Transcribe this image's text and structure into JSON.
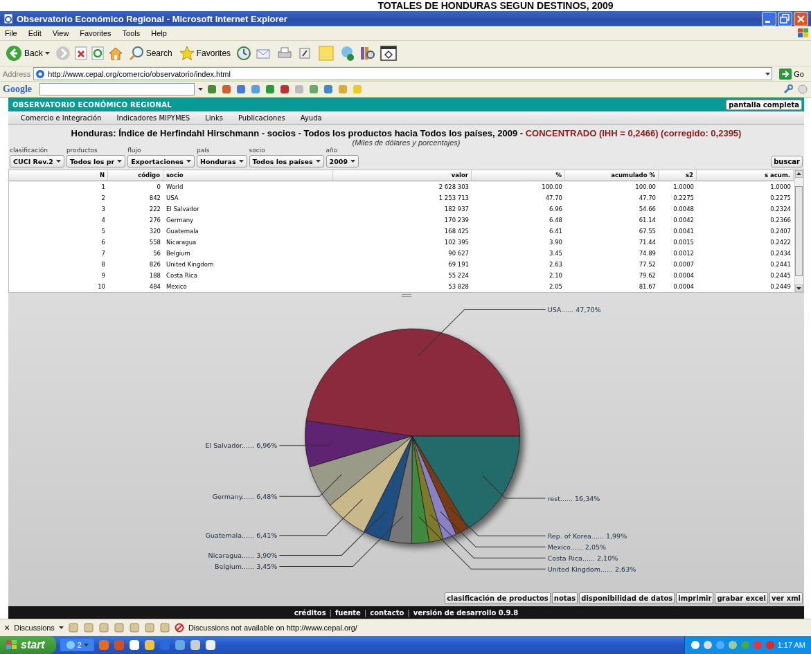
{
  "document_caption": "TOTALES DE  HONDURAS SEGUN DESTINOS, 2009",
  "window": {
    "title": "Observatorio Económico Regional - Microsoft Internet Explorer"
  },
  "menu_bar": [
    "File",
    "Edit",
    "View",
    "Favorites",
    "Tools",
    "Help"
  ],
  "toolbar": {
    "back": "Back",
    "search": "Search",
    "favorites": "Favorites"
  },
  "address_bar": {
    "label": "Address",
    "url": "http://www.cepal.org/comercio/observatorio/index.html",
    "go": "Go"
  },
  "google_bar": {
    "logo": "Google"
  },
  "app": {
    "name": "OBSERVATORIO ECONÓMICO REGIONAL",
    "fullscreen_button": "pantalla completa",
    "nav": [
      "Comercio e Integración",
      "Indicadores MIPYMES",
      "Links",
      "Publicaciones",
      "Ayuda"
    ],
    "title": "Honduras: Índice de Herfindahl Hirschmann - socios - Todos los productos hacia Todos los países, 2009 -",
    "concentration": "CONCENTRADO (IHH = 0,2466) (corregido: 0,2395)",
    "subtitle": "(Miles de dólares y porcentajes)",
    "filters": [
      {
        "label": "clasificación",
        "value": "CUCI Rev.2"
      },
      {
        "label": "productos",
        "value": "Todos los pr"
      },
      {
        "label": "flujo",
        "value": "Exportaciones"
      },
      {
        "label": "país",
        "value": "Honduras"
      },
      {
        "label": "socio",
        "value": "Todos los países"
      },
      {
        "label": "año",
        "value": "2009"
      }
    ],
    "search_button": "buscar",
    "table": {
      "columns": [
        "N",
        "código",
        "socio",
        "valor",
        "%",
        "acumulado %",
        "s2",
        "s acum."
      ],
      "rows": [
        [
          "1",
          "0",
          "World",
          "2 628 303",
          "100.00",
          "100.00",
          "1.0000",
          "1.0000"
        ],
        [
          "2",
          "842",
          "USA",
          "1 253 713",
          "47.70",
          "47.70",
          "0.2275",
          "0.2275"
        ],
        [
          "3",
          "222",
          "El Salvador",
          "182 937",
          "6.96",
          "54.66",
          "0.0048",
          "0.2324"
        ],
        [
          "4",
          "276",
          "Germany",
          "170 239",
          "6.48",
          "61.14",
          "0.0042",
          "0.2366"
        ],
        [
          "5",
          "320",
          "Guatemala",
          "168 425",
          "6.41",
          "67.55",
          "0.0041",
          "0.2407"
        ],
        [
          "6",
          "558",
          "Nicaragua",
          "102 395",
          "3.90",
          "71.44",
          "0.0015",
          "0.2422"
        ],
        [
          "7",
          "56",
          "Belgium",
          "90 627",
          "3.45",
          "74.89",
          "0.0012",
          "0.2434"
        ],
        [
          "8",
          "826",
          "United Kingdom",
          "69 191",
          "2.63",
          "77.52",
          "0.0007",
          "0.2441"
        ],
        [
          "9",
          "188",
          "Costa Rica",
          "55 224",
          "2.10",
          "79.62",
          "0.0004",
          "0.2445"
        ],
        [
          "10",
          "484",
          "Mexico",
          "53 828",
          "2.05",
          "81.67",
          "0.0004",
          "0.2449"
        ]
      ]
    },
    "chart_data": {
      "type": "pie",
      "series": [
        {
          "values": [
            47.7,
            6.96,
            6.48,
            6.41,
            3.9,
            3.45,
            2.63,
            2.1,
            2.05,
            1.99,
            16.34
          ],
          "colors": [
            "#8b2a3c",
            "#5e2472",
            "#9a9a88",
            "#c9b98a",
            "#1f4f80",
            "#777777",
            "#3f8a3f",
            "#7d7a2a",
            "#8a80c8",
            "#7a3b14",
            "#236a6a"
          ]
        }
      ],
      "value_labels": [
        "USA...... 47,70%",
        "El Salvador...... 6,96%",
        "Germany...... 6,48%",
        "Guatemala...... 6,41%",
        "Nicaragua...... 3,90%",
        "Belgium...... 3,45%",
        "United Kingdom...... 2,63%",
        "Costa Rica...... 2,10%",
        "Mexico...... 2,05%",
        "Rep. of Korea...... 1,99%",
        "rest...... 16,34%"
      ]
    },
    "actions": [
      "clasificación de productos",
      "notas",
      "disponibilidad de datos",
      "imprimir",
      "grabar excel",
      "ver xml"
    ],
    "footer": [
      {
        "kind": "link",
        "text": "créditos"
      },
      {
        "kind": "sep",
        "text": "|"
      },
      {
        "kind": "link",
        "text": "fuente"
      },
      {
        "kind": "sep",
        "text": "|"
      },
      {
        "kind": "link",
        "text": "contacto"
      },
      {
        "kind": "sep",
        "text": "|"
      },
      {
        "kind": "text",
        "text": "versión de desarrollo 0.9.8"
      }
    ]
  },
  "discussions_bar": {
    "close": "×",
    "label": "Discussions",
    "message": "Discussions not available on http://www.cepal.org/"
  },
  "taskbar": {
    "start": "start",
    "ie_group": "2",
    "clock": "1:17 AM"
  }
}
